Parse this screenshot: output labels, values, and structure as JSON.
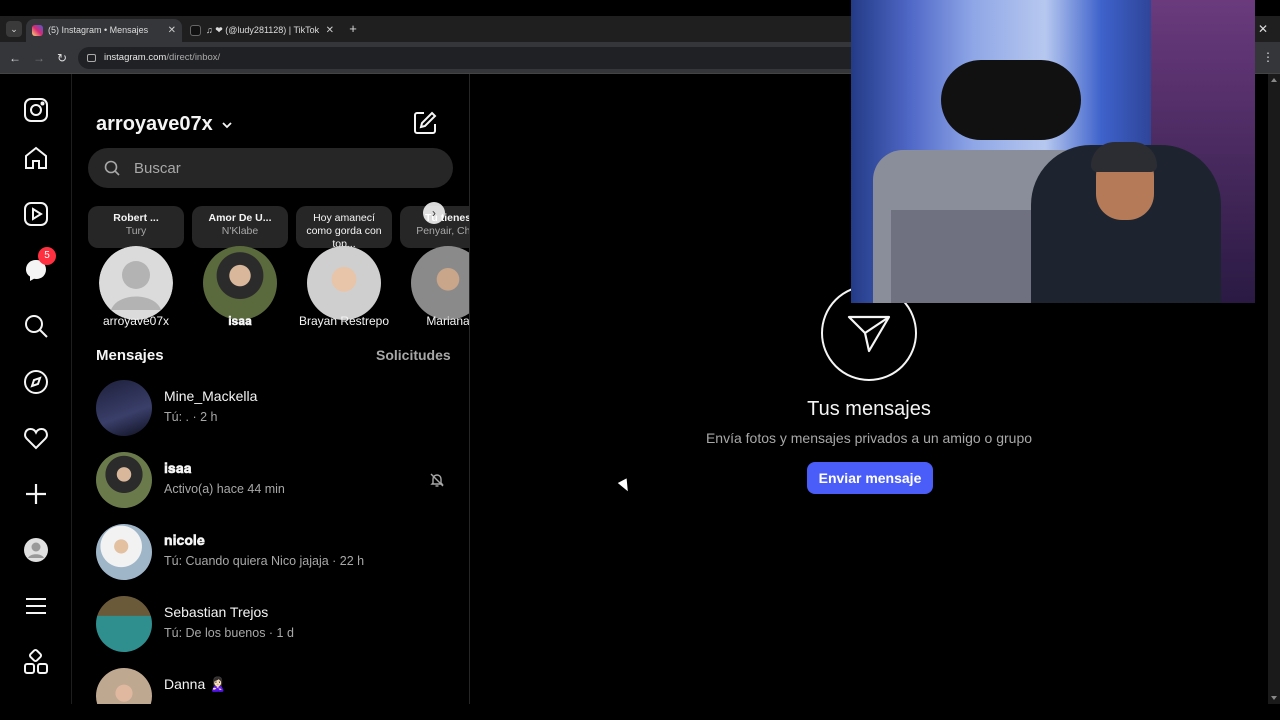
{
  "browser": {
    "tabs": [
      {
        "title": "(5) Instagram • Mensajes",
        "active": true
      },
      {
        "title": "♫ ❤ (@ludy281128) | TikTok",
        "active": false
      }
    ],
    "new_tab": "+",
    "close": "✕",
    "url_host": "instagram.com",
    "url_path": "/direct/inbox/"
  },
  "rail": {
    "icons": [
      "instagram-logo",
      "home",
      "reels",
      "messenger",
      "search",
      "explore",
      "notifications",
      "create",
      "profile",
      "more-menu",
      "threads-apps"
    ],
    "messenger_badge": "5"
  },
  "dm": {
    "account": "arroyave07x",
    "search_placeholder": "Buscar",
    "notes": [
      {
        "line1": "Robert ...",
        "line2": "Tury",
        "name": "arroyave07x"
      },
      {
        "line1": "Amor De U...",
        "line2": "N'Klabe",
        "name": "𝐢𝐬𝐚𝐚"
      },
      {
        "line1": "Hoy amanecí como gorda con top...",
        "line2": "",
        "name": "Brayan Restrepo"
      },
      {
        "line1": "Tú tienes",
        "line2": "Penyair, Char",
        "name": "Mariana"
      }
    ],
    "section_title": "Mensajes",
    "requests": "Solicitudes",
    "threads": [
      {
        "name": "Mine_Mackella",
        "preview": "Tú: . · 2 h",
        "muted": false
      },
      {
        "name": "𝐢𝐬𝐚𝐚",
        "preview": "Activo(a) hace 44 min",
        "muted": true
      },
      {
        "name": "𝐧𝐢𝐜𝐨𝐥𝐞",
        "preview": "Tú: Cuando quiera Nico jajaja · 22 h",
        "muted": false
      },
      {
        "name": "Sebastian Trejos",
        "preview": "Tú: De los buenos · 1 d",
        "muted": false
      },
      {
        "name": "Danna 🙎🏻‍♀️",
        "preview": "",
        "muted": false
      }
    ]
  },
  "main": {
    "title": "Tus mensajes",
    "subtitle": "Envía fotos y mensajes privados a un amigo o grupo",
    "button": "Enviar mensaje"
  },
  "colors": {
    "accent": "#4a5df9",
    "badge": "#ff3040",
    "background": "#000000",
    "muted_text": "#a8a8a8"
  }
}
